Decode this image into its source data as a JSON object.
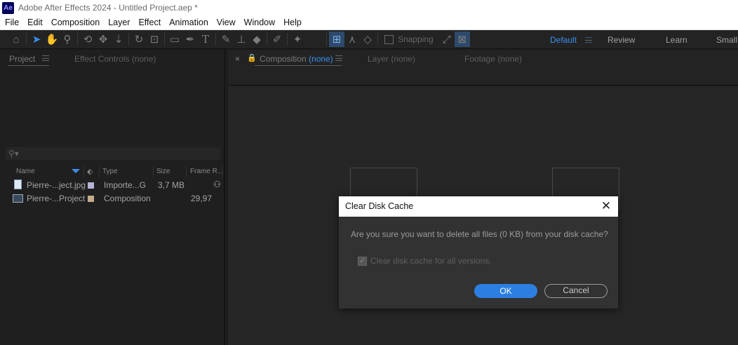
{
  "window": {
    "app_badge": "Ae",
    "title": "Adobe After Effects 2024 - Untitled Project.aep *"
  },
  "menu": [
    "File",
    "Edit",
    "Composition",
    "Layer",
    "Effect",
    "Animation",
    "View",
    "Window",
    "Help"
  ],
  "toolbar": {
    "snapping_label": "Snapping",
    "workspaces": [
      "Default",
      "Review",
      "Learn",
      "Small"
    ],
    "active_workspace": "Default",
    "accent_color": "#3b8ff2"
  },
  "project_panel": {
    "tabs": [
      "Project",
      "Effect Controls (none)"
    ],
    "columns": [
      "Name",
      "Type",
      "Size",
      "Frame R..."
    ],
    "items": [
      {
        "name": "Pierre-...ject.jpg",
        "type": "Importe...G",
        "size": "3,7 MB",
        "frame_rate": "",
        "label_color": "#b4b4d8",
        "icon": "image-file-icon"
      },
      {
        "name": "Pierre-...Project",
        "type": "Composition",
        "size": "",
        "frame_rate": "29,97",
        "label_color": "#c4ac8a",
        "icon": "composition-icon"
      }
    ]
  },
  "viewer_panel": {
    "composition_tab": "Composition",
    "composition_tab_value": "(none)",
    "tabs": [
      "Layer (none)",
      "Footage (none)"
    ]
  },
  "dialog": {
    "title": "Clear Disk Cache",
    "message": "Are you sure you want to delete all files (0 KB) from your disk cache?",
    "checkbox_label": "Clear disk cache for all versions.",
    "checkbox_checked": true,
    "ok_label": "OK",
    "cancel_label": "Cancel"
  }
}
